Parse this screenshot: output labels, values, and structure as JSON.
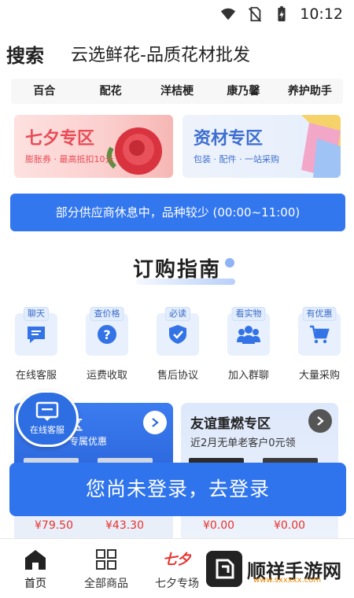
{
  "status_bar": {
    "time": "10:12"
  },
  "header": {
    "search_label": "搜索",
    "app_title": "云选鲜花-品质花材批发"
  },
  "categories": [
    "百合",
    "配花",
    "洋桔梗",
    "康乃馨",
    "养护助手"
  ],
  "promos": {
    "qixi": {
      "title": "七夕专区",
      "subtitle": "膨胀券 · 最高抵扣10元"
    },
    "material": {
      "title": "资材专区",
      "subtitle": "包装 · 配件 · 一站采购"
    }
  },
  "notice": "部分供应商休息中，品种较少 (00:00~11:00)",
  "guide": {
    "title": "订购指南"
  },
  "services": [
    {
      "tag": "聊天",
      "label": "在线客服",
      "icon": "chat-icon"
    },
    {
      "tag": "查价格",
      "label": "运费收取",
      "icon": "question-icon"
    },
    {
      "tag": "必读",
      "label": "售后协议",
      "icon": "shield-check-icon"
    },
    {
      "tag": "看实物",
      "label": "加入群聊",
      "icon": "group-icon"
    },
    {
      "tag": "有优惠",
      "label": "大量采购",
      "icon": "cart-icon"
    }
  ],
  "panel_left": {
    "heading": "区",
    "subtitle": "专属优惠",
    "prices": [
      "¥79.50",
      "¥43.30"
    ]
  },
  "panel_right": {
    "heading": "友谊重燃专区",
    "subtitle": "近2月无单老客户0元领",
    "prices": [
      "¥0.00",
      "¥0.00"
    ]
  },
  "float_cs": {
    "label": "在线客服"
  },
  "login": {
    "label": "您尚未登录，去登录"
  },
  "bottom_nav": [
    {
      "label": "首页",
      "icon": "home-icon",
      "active": true
    },
    {
      "label": "全部商品",
      "icon": "grid-icon",
      "active": false
    },
    {
      "label": "七夕专场",
      "icon": "qixi-icon",
      "active": false
    }
  ],
  "watermark": {
    "text": "顺祥手游网",
    "site": "www.sxxxxx.com"
  },
  "colors": {
    "accent": "#2f74ec",
    "price_red": "#e8322e",
    "qixi_red": "#e94c56"
  }
}
